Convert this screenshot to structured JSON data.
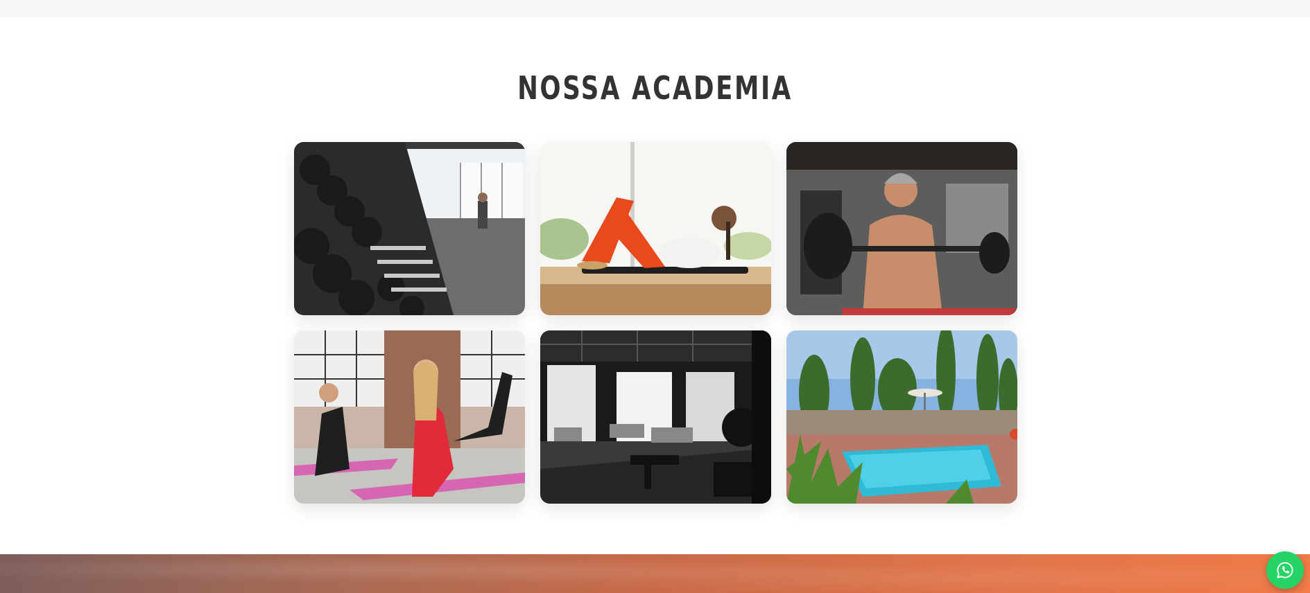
{
  "section": {
    "title": "NOSSA ACADEMIA"
  },
  "gallery": {
    "images": [
      {
        "subject": "dumbbell-rack",
        "icon": "gym-weights-photo"
      },
      {
        "subject": "woman-doing-crunches",
        "icon": "abs-workout-photo"
      },
      {
        "subject": "man-barbell-curl",
        "icon": "weightlifting-photo"
      },
      {
        "subject": "women-group-floor-exercise",
        "icon": "group-class-photo"
      },
      {
        "subject": "gym-interior-black-white",
        "icon": "gym-interior-photo"
      },
      {
        "subject": "outdoor-pool",
        "icon": "pool-photo"
      }
    ]
  },
  "floating": {
    "icon": "whatsapp-icon",
    "color": "#25d366"
  },
  "colors": {
    "title": "#333333",
    "banner_start": "#7e5e5b",
    "banner_end": "#f07a48"
  }
}
